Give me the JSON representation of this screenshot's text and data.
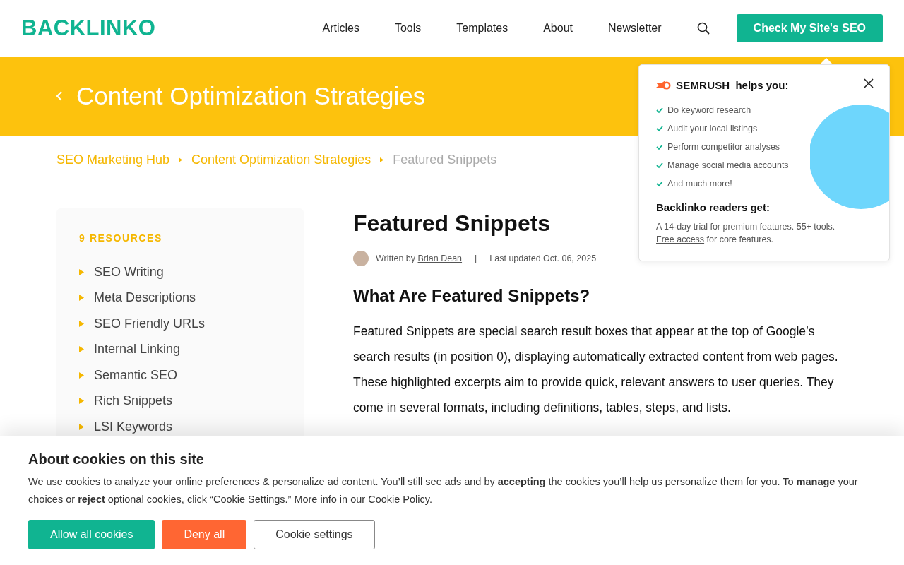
{
  "header": {
    "logo": "BACKLINKO",
    "nav": [
      "Articles",
      "Tools",
      "Templates",
      "About",
      "Newsletter"
    ],
    "cta": "Check My Site's SEO"
  },
  "hero": {
    "title": "Content Optimization Strategies"
  },
  "breadcrumb": [
    {
      "label": "SEO Marketing Hub",
      "current": false
    },
    {
      "label": "Content Optimization Strategies",
      "current": false
    },
    {
      "label": "Featured Snippets",
      "current": true
    }
  ],
  "sidebar": {
    "heading": "9 RESOURCES",
    "items": [
      "SEO Writing",
      "Meta Descriptions",
      "SEO Friendly URLs",
      "Internal Linking",
      "Semantic SEO",
      "Rich Snippets",
      "LSI Keywords"
    ]
  },
  "article": {
    "title": "Featured Snippets",
    "byline_prefix": "Written by",
    "author": "Brian Dean",
    "separator": "|",
    "updated": "Last updated Oct. 06, 2025",
    "heading": "What Are Featured Snippets?",
    "paragraph": "Featured Snippets are special search result boxes that appear at the top of Google’s search results (in position 0), displaying automatically extracted content from web pages. These highlighted excerpts aim to provide quick, relevant answers to user queries. They come in several formats, including definitions, tables, steps, and lists."
  },
  "promo": {
    "brand": "SEMRUSH",
    "tagline": "helps you:",
    "benefits": [
      "Do keyword research",
      "Audit your local listings",
      "Perform competitor analyses",
      "Manage social media accounts",
      "And much more!"
    ],
    "subheading": "Backlinko readers get:",
    "text": "A 14-day trial for premium features. 55+ tools.",
    "link": "Free access",
    "text_after": "for core features."
  },
  "cookie": {
    "title": "About cookies on this site",
    "text": "We use cookies to analyze your online preferences & personalize ad content. You’ll still see ads and by **accepting** the cookies you’ll help us personalize them for you. To **manage** your choices or **reject** optional cookies, click “Cookie Settings.” More info in our",
    "link": "Cookie Policy.",
    "buttons": [
      {
        "label": "Allow all cookies",
        "kind": "allow"
      },
      {
        "label": "Deny all",
        "kind": "deny"
      },
      {
        "label": "Cookie settings",
        "kind": "settings"
      }
    ]
  }
}
